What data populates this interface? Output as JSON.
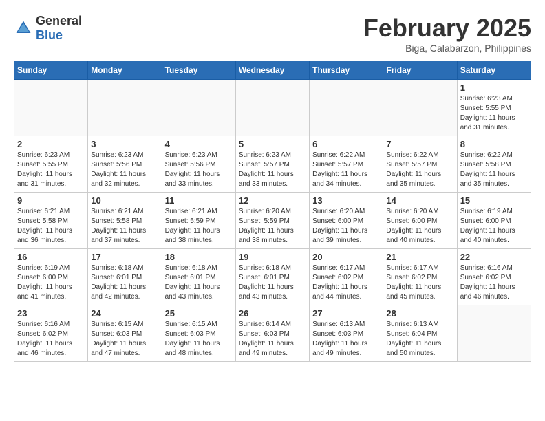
{
  "header": {
    "logo_general": "General",
    "logo_blue": "Blue",
    "month_year": "February 2025",
    "location": "Biga, Calabarzon, Philippines"
  },
  "weekdays": [
    "Sunday",
    "Monday",
    "Tuesday",
    "Wednesday",
    "Thursday",
    "Friday",
    "Saturday"
  ],
  "weeks": [
    [
      {
        "day": "",
        "info": ""
      },
      {
        "day": "",
        "info": ""
      },
      {
        "day": "",
        "info": ""
      },
      {
        "day": "",
        "info": ""
      },
      {
        "day": "",
        "info": ""
      },
      {
        "day": "",
        "info": ""
      },
      {
        "day": "1",
        "info": "Sunrise: 6:23 AM\nSunset: 5:55 PM\nDaylight: 11 hours\nand 31 minutes."
      }
    ],
    [
      {
        "day": "2",
        "info": "Sunrise: 6:23 AM\nSunset: 5:55 PM\nDaylight: 11 hours\nand 31 minutes."
      },
      {
        "day": "3",
        "info": "Sunrise: 6:23 AM\nSunset: 5:56 PM\nDaylight: 11 hours\nand 32 minutes."
      },
      {
        "day": "4",
        "info": "Sunrise: 6:23 AM\nSunset: 5:56 PM\nDaylight: 11 hours\nand 33 minutes."
      },
      {
        "day": "5",
        "info": "Sunrise: 6:23 AM\nSunset: 5:57 PM\nDaylight: 11 hours\nand 33 minutes."
      },
      {
        "day": "6",
        "info": "Sunrise: 6:22 AM\nSunset: 5:57 PM\nDaylight: 11 hours\nand 34 minutes."
      },
      {
        "day": "7",
        "info": "Sunrise: 6:22 AM\nSunset: 5:57 PM\nDaylight: 11 hours\nand 35 minutes."
      },
      {
        "day": "8",
        "info": "Sunrise: 6:22 AM\nSunset: 5:58 PM\nDaylight: 11 hours\nand 35 minutes."
      }
    ],
    [
      {
        "day": "9",
        "info": "Sunrise: 6:21 AM\nSunset: 5:58 PM\nDaylight: 11 hours\nand 36 minutes."
      },
      {
        "day": "10",
        "info": "Sunrise: 6:21 AM\nSunset: 5:58 PM\nDaylight: 11 hours\nand 37 minutes."
      },
      {
        "day": "11",
        "info": "Sunrise: 6:21 AM\nSunset: 5:59 PM\nDaylight: 11 hours\nand 38 minutes."
      },
      {
        "day": "12",
        "info": "Sunrise: 6:20 AM\nSunset: 5:59 PM\nDaylight: 11 hours\nand 38 minutes."
      },
      {
        "day": "13",
        "info": "Sunrise: 6:20 AM\nSunset: 6:00 PM\nDaylight: 11 hours\nand 39 minutes."
      },
      {
        "day": "14",
        "info": "Sunrise: 6:20 AM\nSunset: 6:00 PM\nDaylight: 11 hours\nand 40 minutes."
      },
      {
        "day": "15",
        "info": "Sunrise: 6:19 AM\nSunset: 6:00 PM\nDaylight: 11 hours\nand 40 minutes."
      }
    ],
    [
      {
        "day": "16",
        "info": "Sunrise: 6:19 AM\nSunset: 6:00 PM\nDaylight: 11 hours\nand 41 minutes."
      },
      {
        "day": "17",
        "info": "Sunrise: 6:18 AM\nSunset: 6:01 PM\nDaylight: 11 hours\nand 42 minutes."
      },
      {
        "day": "18",
        "info": "Sunrise: 6:18 AM\nSunset: 6:01 PM\nDaylight: 11 hours\nand 43 minutes."
      },
      {
        "day": "19",
        "info": "Sunrise: 6:18 AM\nSunset: 6:01 PM\nDaylight: 11 hours\nand 43 minutes."
      },
      {
        "day": "20",
        "info": "Sunrise: 6:17 AM\nSunset: 6:02 PM\nDaylight: 11 hours\nand 44 minutes."
      },
      {
        "day": "21",
        "info": "Sunrise: 6:17 AM\nSunset: 6:02 PM\nDaylight: 11 hours\nand 45 minutes."
      },
      {
        "day": "22",
        "info": "Sunrise: 6:16 AM\nSunset: 6:02 PM\nDaylight: 11 hours\nand 46 minutes."
      }
    ],
    [
      {
        "day": "23",
        "info": "Sunrise: 6:16 AM\nSunset: 6:02 PM\nDaylight: 11 hours\nand 46 minutes."
      },
      {
        "day": "24",
        "info": "Sunrise: 6:15 AM\nSunset: 6:03 PM\nDaylight: 11 hours\nand 47 minutes."
      },
      {
        "day": "25",
        "info": "Sunrise: 6:15 AM\nSunset: 6:03 PM\nDaylight: 11 hours\nand 48 minutes."
      },
      {
        "day": "26",
        "info": "Sunrise: 6:14 AM\nSunset: 6:03 PM\nDaylight: 11 hours\nand 49 minutes."
      },
      {
        "day": "27",
        "info": "Sunrise: 6:13 AM\nSunset: 6:03 PM\nDaylight: 11 hours\nand 49 minutes."
      },
      {
        "day": "28",
        "info": "Sunrise: 6:13 AM\nSunset: 6:04 PM\nDaylight: 11 hours\nand 50 minutes."
      },
      {
        "day": "",
        "info": ""
      }
    ]
  ]
}
